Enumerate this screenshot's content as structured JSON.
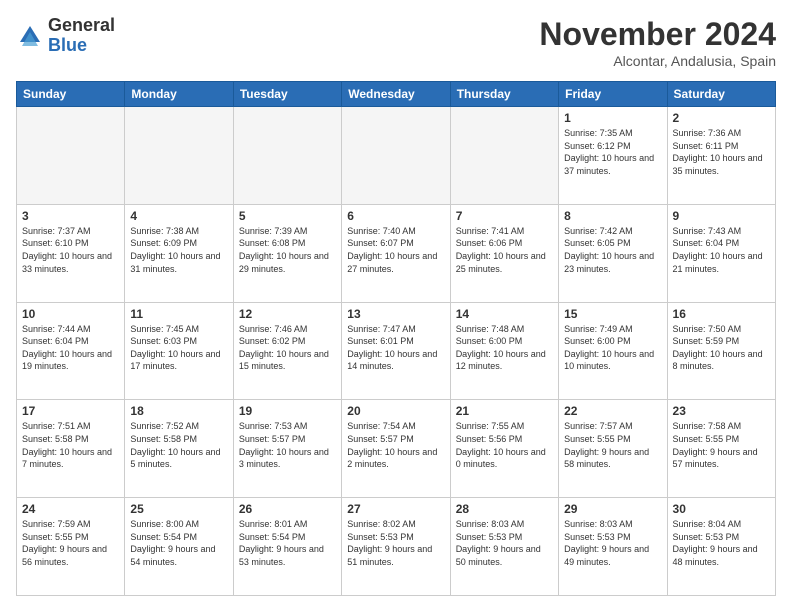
{
  "logo": {
    "general": "General",
    "blue": "Blue"
  },
  "header": {
    "month": "November 2024",
    "location": "Alcontar, Andalusia, Spain"
  },
  "days_of_week": [
    "Sunday",
    "Monday",
    "Tuesday",
    "Wednesday",
    "Thursday",
    "Friday",
    "Saturday"
  ],
  "weeks": [
    [
      {
        "day": "",
        "info": ""
      },
      {
        "day": "",
        "info": ""
      },
      {
        "day": "",
        "info": ""
      },
      {
        "day": "",
        "info": ""
      },
      {
        "day": "",
        "info": ""
      },
      {
        "day": "1",
        "info": "Sunrise: 7:35 AM\nSunset: 6:12 PM\nDaylight: 10 hours and 37 minutes."
      },
      {
        "day": "2",
        "info": "Sunrise: 7:36 AM\nSunset: 6:11 PM\nDaylight: 10 hours and 35 minutes."
      }
    ],
    [
      {
        "day": "3",
        "info": "Sunrise: 7:37 AM\nSunset: 6:10 PM\nDaylight: 10 hours and 33 minutes."
      },
      {
        "day": "4",
        "info": "Sunrise: 7:38 AM\nSunset: 6:09 PM\nDaylight: 10 hours and 31 minutes."
      },
      {
        "day": "5",
        "info": "Sunrise: 7:39 AM\nSunset: 6:08 PM\nDaylight: 10 hours and 29 minutes."
      },
      {
        "day": "6",
        "info": "Sunrise: 7:40 AM\nSunset: 6:07 PM\nDaylight: 10 hours and 27 minutes."
      },
      {
        "day": "7",
        "info": "Sunrise: 7:41 AM\nSunset: 6:06 PM\nDaylight: 10 hours and 25 minutes."
      },
      {
        "day": "8",
        "info": "Sunrise: 7:42 AM\nSunset: 6:05 PM\nDaylight: 10 hours and 23 minutes."
      },
      {
        "day": "9",
        "info": "Sunrise: 7:43 AM\nSunset: 6:04 PM\nDaylight: 10 hours and 21 minutes."
      }
    ],
    [
      {
        "day": "10",
        "info": "Sunrise: 7:44 AM\nSunset: 6:04 PM\nDaylight: 10 hours and 19 minutes."
      },
      {
        "day": "11",
        "info": "Sunrise: 7:45 AM\nSunset: 6:03 PM\nDaylight: 10 hours and 17 minutes."
      },
      {
        "day": "12",
        "info": "Sunrise: 7:46 AM\nSunset: 6:02 PM\nDaylight: 10 hours and 15 minutes."
      },
      {
        "day": "13",
        "info": "Sunrise: 7:47 AM\nSunset: 6:01 PM\nDaylight: 10 hours and 14 minutes."
      },
      {
        "day": "14",
        "info": "Sunrise: 7:48 AM\nSunset: 6:00 PM\nDaylight: 10 hours and 12 minutes."
      },
      {
        "day": "15",
        "info": "Sunrise: 7:49 AM\nSunset: 6:00 PM\nDaylight: 10 hours and 10 minutes."
      },
      {
        "day": "16",
        "info": "Sunrise: 7:50 AM\nSunset: 5:59 PM\nDaylight: 10 hours and 8 minutes."
      }
    ],
    [
      {
        "day": "17",
        "info": "Sunrise: 7:51 AM\nSunset: 5:58 PM\nDaylight: 10 hours and 7 minutes."
      },
      {
        "day": "18",
        "info": "Sunrise: 7:52 AM\nSunset: 5:58 PM\nDaylight: 10 hours and 5 minutes."
      },
      {
        "day": "19",
        "info": "Sunrise: 7:53 AM\nSunset: 5:57 PM\nDaylight: 10 hours and 3 minutes."
      },
      {
        "day": "20",
        "info": "Sunrise: 7:54 AM\nSunset: 5:57 PM\nDaylight: 10 hours and 2 minutes."
      },
      {
        "day": "21",
        "info": "Sunrise: 7:55 AM\nSunset: 5:56 PM\nDaylight: 10 hours and 0 minutes."
      },
      {
        "day": "22",
        "info": "Sunrise: 7:57 AM\nSunset: 5:55 PM\nDaylight: 9 hours and 58 minutes."
      },
      {
        "day": "23",
        "info": "Sunrise: 7:58 AM\nSunset: 5:55 PM\nDaylight: 9 hours and 57 minutes."
      }
    ],
    [
      {
        "day": "24",
        "info": "Sunrise: 7:59 AM\nSunset: 5:55 PM\nDaylight: 9 hours and 56 minutes."
      },
      {
        "day": "25",
        "info": "Sunrise: 8:00 AM\nSunset: 5:54 PM\nDaylight: 9 hours and 54 minutes."
      },
      {
        "day": "26",
        "info": "Sunrise: 8:01 AM\nSunset: 5:54 PM\nDaylight: 9 hours and 53 minutes."
      },
      {
        "day": "27",
        "info": "Sunrise: 8:02 AM\nSunset: 5:53 PM\nDaylight: 9 hours and 51 minutes."
      },
      {
        "day": "28",
        "info": "Sunrise: 8:03 AM\nSunset: 5:53 PM\nDaylight: 9 hours and 50 minutes."
      },
      {
        "day": "29",
        "info": "Sunrise: 8:03 AM\nSunset: 5:53 PM\nDaylight: 9 hours and 49 minutes."
      },
      {
        "day": "30",
        "info": "Sunrise: 8:04 AM\nSunset: 5:53 PM\nDaylight: 9 hours and 48 minutes."
      }
    ]
  ]
}
